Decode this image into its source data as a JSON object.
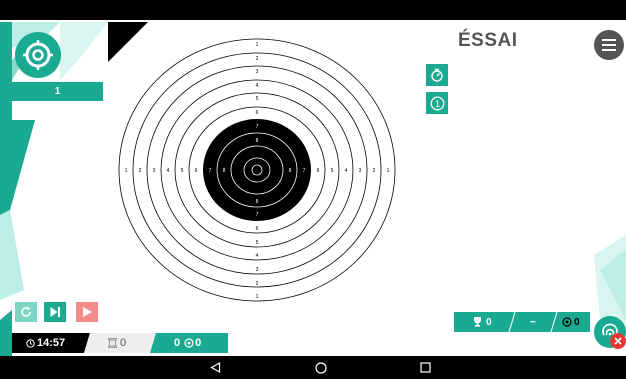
{
  "header": {
    "title": "ÉSSAI"
  },
  "shot_counter": {
    "value": "1"
  },
  "target": {
    "ring_labels_vertical_top": [
      "1",
      "2",
      "3",
      "4",
      "5",
      "6",
      "7",
      "8"
    ],
    "ring_labels_vertical_bottom": [
      "8",
      "7",
      "6",
      "5",
      "4",
      "3",
      "2",
      "1"
    ],
    "ring_labels_left": [
      "1",
      "2",
      "3",
      "4",
      "5",
      "6",
      "7",
      "8"
    ],
    "ring_labels_right": [
      "8",
      "7",
      "6",
      "5",
      "4",
      "3",
      "2",
      "1"
    ]
  },
  "side_buttons": {
    "timer_icon": "stopwatch-icon",
    "one_icon": "number-one-icon",
    "one_label": "1"
  },
  "score_bar": {
    "trophy_value": "0",
    "middle_value": "~",
    "tens_value": "0"
  },
  "bottom_bar": {
    "time": "14:57",
    "series_value": "0",
    "shots_value": "0"
  },
  "colors": {
    "accent": "#1aaa92",
    "accent_light": "#7fd6c6",
    "danger": "#e53935",
    "pink": "#f28b8b"
  }
}
